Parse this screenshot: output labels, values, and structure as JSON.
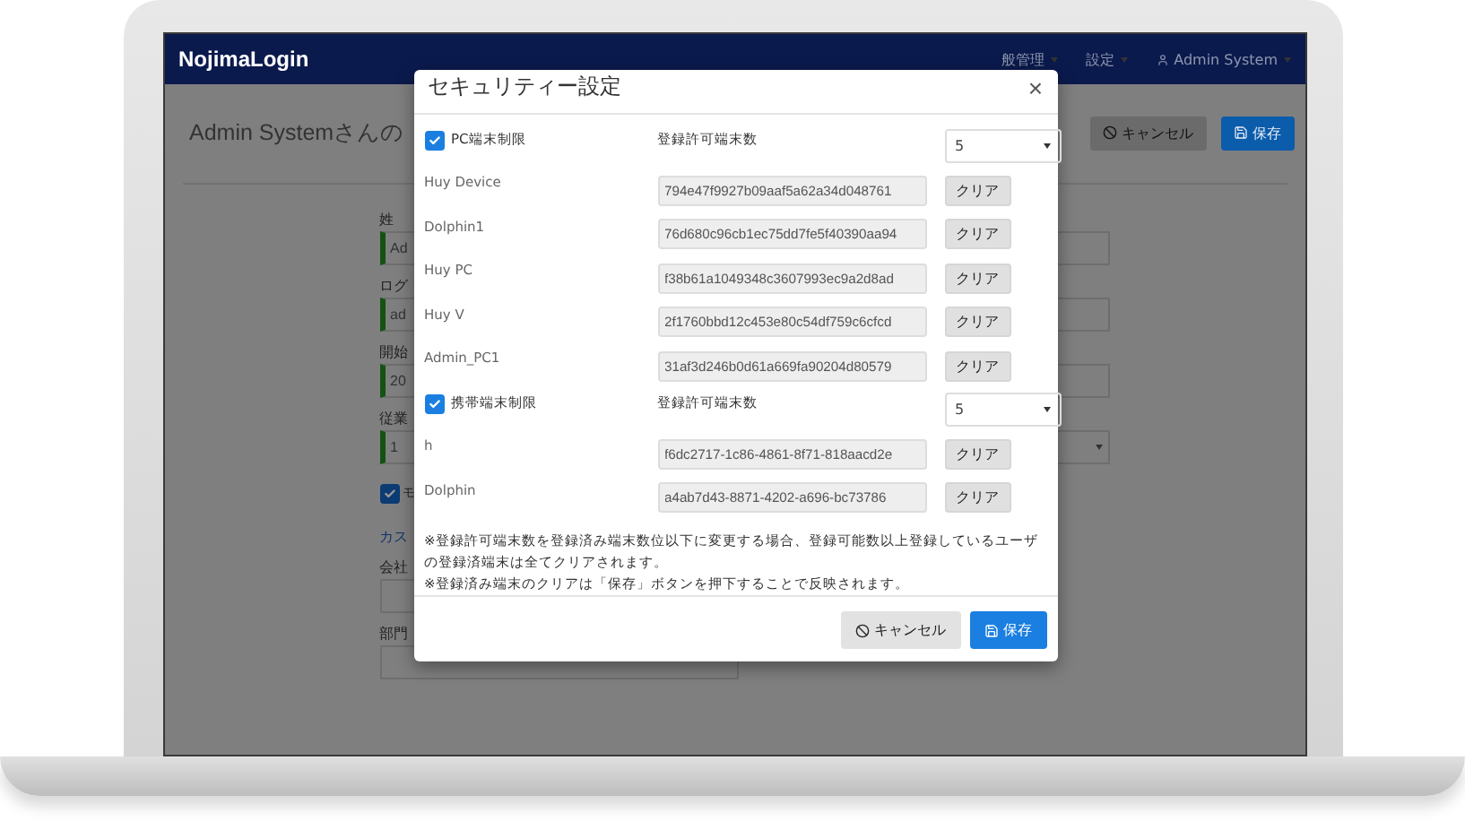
{
  "navbar": {
    "logo": "NojimaLogin",
    "items": [
      {
        "label": "般管理",
        "kind": "menu"
      },
      {
        "label": "設定",
        "kind": "menu"
      },
      {
        "label": "Admin System",
        "kind": "user"
      }
    ]
  },
  "page": {
    "title": "Admin Systemさんの",
    "buttons": [
      {
        "label": "キャンセル",
        "kind": "cancel"
      },
      {
        "label": "保存",
        "kind": "save"
      }
    ],
    "fields": [
      {
        "label": "姓",
        "value": "Ad"
      },
      {
        "label": "ログ",
        "value": "ad"
      },
      {
        "label": "開始",
        "value": "20"
      },
      {
        "label": "従業",
        "value": "1"
      }
    ],
    "checkbox": {
      "label": "モ",
      "checked": true
    },
    "section_link": "カス",
    "empty_fields": [
      {
        "label": "会社"
      },
      {
        "label": "部門"
      }
    ]
  },
  "modal": {
    "title": "セキュリティー設定",
    "close": "×",
    "groups": [
      {
        "label": "PC端末制限",
        "checked": true,
        "limit_label": "登録許可端末数",
        "limit": "5",
        "devices": [
          {
            "name": "Huy Device",
            "token": "794e47f9927b09aaf5a62a34d048761",
            "action": "クリア"
          },
          {
            "name": "Dolphin1",
            "token": "76d680c96cb1ec75dd7fe5f40390aa94",
            "action": "クリア"
          },
          {
            "name": "Huy PC",
            "token": "f38b61a1049348c3607993ec9a2d8ad",
            "action": "クリア"
          },
          {
            "name": "Huy V",
            "token": "2f1760bbd12c453e80c54df759c6cfcd",
            "action": "クリア"
          },
          {
            "name": "Admin_PC1",
            "token": "31af3d246b0d61a669fa90204d80579",
            "action": "クリア"
          }
        ]
      },
      {
        "label": "携帯端末制限",
        "checked": true,
        "limit_label": "登録許可端末数",
        "limit": "5",
        "devices": [
          {
            "name": "h",
            "token": "f6dc2717-1c86-4861-8f71-818aacd2e",
            "action": "クリア"
          },
          {
            "name": "Dolphin",
            "token": "a4ab7d43-8871-4202-a696-bc73786",
            "action": "クリア"
          }
        ]
      }
    ],
    "notes": [
      "※登録許可端末数を登録済み端末数位以下に変更する場合、登録可能数以上登録しているユーザの登録済端末は全てクリアされます。",
      "※登録済み端末のクリアは「保存」ボタンを押下することで反映されます。"
    ],
    "buttons": [
      {
        "label": "キャンセル",
        "kind": "cancel"
      },
      {
        "label": "保存",
        "kind": "save"
      }
    ]
  }
}
